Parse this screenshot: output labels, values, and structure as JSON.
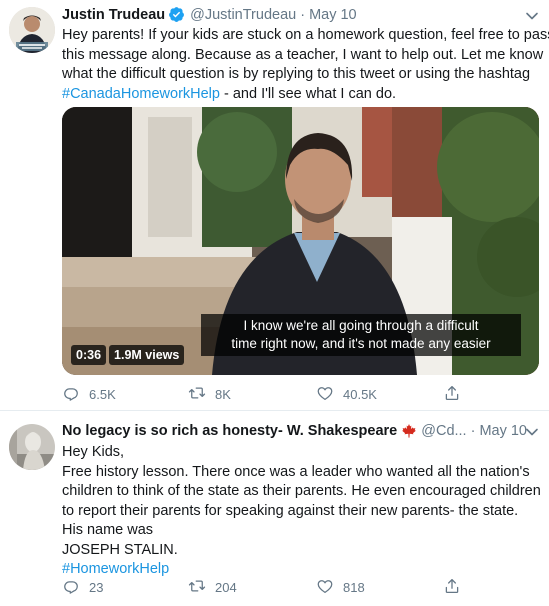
{
  "tweets": [
    {
      "name": "Justin Trudeau",
      "handle": "@JustinTrudeau",
      "separator": "·",
      "date": "May 10",
      "text_lines": [
        "Hey parents! If your kids are stuck on a homework question, feel free to pass",
        "this message along. Because as a teacher, I want to help out. Let me know",
        "what the difficult question is by replying to this tweet or using the hashtag"
      ],
      "hashtag": "#CanadaHomeworkHelp",
      "text_tail": " - and I'll see what I can do.",
      "video": {
        "caption_line1": "I know we're all going through a difficult",
        "caption_line2": "time right now, and it's not made any easier",
        "duration": "0:36",
        "views": "1.9M views"
      },
      "stats": {
        "replies": "6.5K",
        "retweets": "8K",
        "likes": "40.5K"
      }
    },
    {
      "name": "No legacy is so rich as honesty- W. Shakespeare",
      "handle": "@Cd...",
      "separator": "·",
      "date": "May 10",
      "text_lines": [
        "Hey Kids,",
        "Free history lesson. There once was a leader who wanted all the nation's",
        "children to think of the state as their parents. He even encouraged children",
        "to report their parents for speaking against their new parents- the state.",
        "His name was",
        "JOSEPH STALIN."
      ],
      "hashtag": "#HomeworkHelp",
      "stats": {
        "replies": "23",
        "retweets": "204",
        "likes": "818"
      }
    }
  ],
  "colors": {
    "link": "#1b95e0",
    "verified": "#1da1f2",
    "maple": "#d52b1e",
    "muted": "#657786",
    "text": "#14171a"
  },
  "icons": [
    "verified-badge-icon",
    "maple-leaf-icon",
    "chevron-down-icon",
    "reply-icon",
    "retweet-icon",
    "like-icon",
    "share-icon"
  ]
}
